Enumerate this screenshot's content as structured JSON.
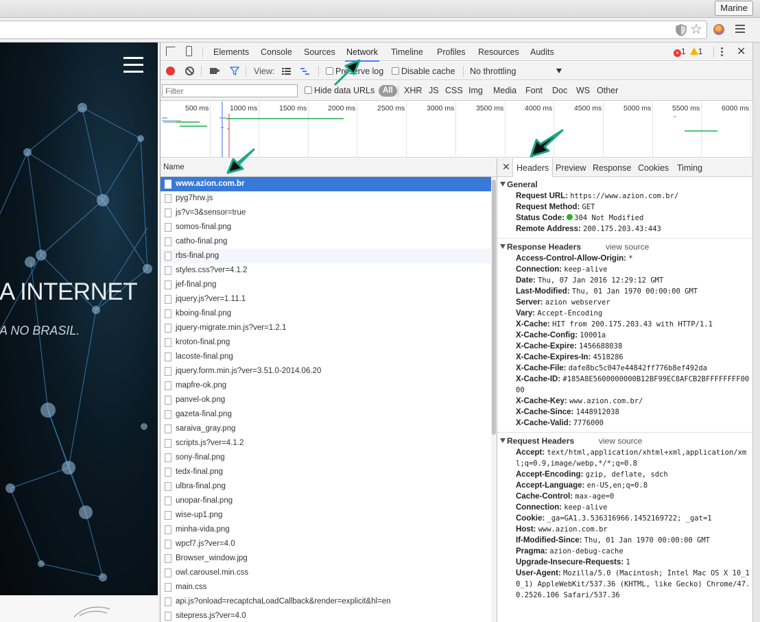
{
  "browser": {
    "profile_name": "Marine",
    "icons": [
      "shield-icon",
      "star-icon",
      "extension-icon",
      "menu-icon"
    ]
  },
  "page": {
    "hero_title": "A INTERNET",
    "hero_subtitle": "A NO BRASIL."
  },
  "devtools": {
    "tabs": [
      "Elements",
      "Console",
      "Sources",
      "Network",
      "Timeline",
      "Profiles",
      "Resources",
      "Audits"
    ],
    "active_tab": "Network",
    "error_count": "1",
    "warning_count": "1",
    "toolbar": {
      "view_label": "View:",
      "preserve_log": "Preserve log",
      "disable_cache": "Disable cache",
      "throttling": "No throttling"
    },
    "filter": {
      "placeholder": "Filter",
      "hide_data_urls": "Hide data URLs",
      "types": [
        "All",
        "XHR",
        "JS",
        "CSS",
        "Img",
        "Media",
        "Font",
        "Doc",
        "WS",
        "Other"
      ]
    },
    "overview_ticks": [
      "500 ms",
      "1000 ms",
      "1500 ms",
      "2000 ms",
      "2500 ms",
      "3000 ms",
      "3500 ms",
      "4000 ms",
      "4500 ms",
      "5000 ms",
      "5500 ms",
      "6000 ms"
    ],
    "name_column": "Name",
    "requests": [
      "www.azion.com.br",
      "pyg7hrw.js",
      "js?v=3&sensor=true",
      "somos-final.png",
      "catho-final.png",
      "rbs-final.png",
      "styles.css?ver=4.1.2",
      "jef-final.png",
      "jquery.js?ver=1.11.1",
      "kboing-final.png",
      "jquery-migrate.min.js?ver=1.2.1",
      "kroton-final.png",
      "lacoste-final.png",
      "jquery.form.min.js?ver=3.51.0-2014.06.20",
      "mapfre-ok.png",
      "panvel-ok.png",
      "gazeta-final.png",
      "saraiva_gray.png",
      "scripts.js?ver=4.1.2",
      "sony-final.png",
      "tedx-final.png",
      "ulbra-final.png",
      "unopar-final.png",
      "wise-up1.png",
      "minha-vida.png",
      "wpcf7.js?ver=4.0",
      "Browser_window.jpg",
      "owl.carousel.min.css",
      "main.css",
      "api.js?onload=recaptchaLoadCallback&render=explicit&hl=en",
      "sitepress.js?ver=4.0"
    ],
    "detail_tabs": [
      "Headers",
      "Preview",
      "Response",
      "Cookies",
      "Timing"
    ],
    "active_detail_tab": "Headers",
    "general": {
      "title": "General",
      "rows": [
        {
          "k": "Request URL:",
          "v": "https://www.azion.com.br/"
        },
        {
          "k": "Request Method:",
          "v": "GET"
        },
        {
          "k": "Status Code:",
          "v": "304 Not Modified"
        },
        {
          "k": "Remote Address:",
          "v": "200.175.203.43:443"
        }
      ]
    },
    "response_headers": {
      "title": "Response Headers",
      "view_source": "view source",
      "rows": [
        {
          "k": "Access-Control-Allow-Origin:",
          "v": "*"
        },
        {
          "k": "Connection:",
          "v": "keep-alive"
        },
        {
          "k": "Date:",
          "v": "Thu, 07 Jan 2016 12:29:12 GMT"
        },
        {
          "k": "Last-Modified:",
          "v": "Thu, 01 Jan 1970 00:00:00 GMT"
        },
        {
          "k": "Server:",
          "v": "azion webserver"
        },
        {
          "k": "Vary:",
          "v": "Accept-Encoding"
        },
        {
          "k": "X-Cache:",
          "v": "HIT from 200.175.203.43 with HTTP/1.1"
        },
        {
          "k": "X-Cache-Config:",
          "v": "10001a"
        },
        {
          "k": "X-Cache-Expire:",
          "v": "1456688038"
        },
        {
          "k": "X-Cache-Expires-In:",
          "v": "4518286"
        },
        {
          "k": "X-Cache-File:",
          "v": "dafe8bc5c047e44842ff776b8ef492da"
        },
        {
          "k": "X-Cache-ID:",
          "v": "#185A8E5600000000B12BF99EC8AFCB2BFFFFFFFF0000"
        },
        {
          "k": "X-Cache-Key:",
          "v": "www.azion.com.br/"
        },
        {
          "k": "X-Cache-Since:",
          "v": "1448912038"
        },
        {
          "k": "X-Cache-Valid:",
          "v": "7776000"
        }
      ]
    },
    "request_headers": {
      "title": "Request Headers",
      "view_source": "view source",
      "rows": [
        {
          "k": "Accept:",
          "v": "text/html,application/xhtml+xml,application/xml;q=0.9,image/webp,*/*;q=0.8"
        },
        {
          "k": "Accept-Encoding:",
          "v": "gzip, deflate, sdch"
        },
        {
          "k": "Accept-Language:",
          "v": "en-US,en;q=0.8"
        },
        {
          "k": "Cache-Control:",
          "v": "max-age=0"
        },
        {
          "k": "Connection:",
          "v": "keep-alive"
        },
        {
          "k": "Cookie:",
          "v": "_ga=GA1.3.536316966.1452169722; _gat=1"
        },
        {
          "k": "Host:",
          "v": "www.azion.com.br"
        },
        {
          "k": "If-Modified-Since:",
          "v": "Thu, 01 Jan 1970 00:00:00 GMT"
        },
        {
          "k": "Pragma:",
          "v": "azion-debug-cache"
        },
        {
          "k": "Upgrade-Insecure-Requests:",
          "v": "1"
        },
        {
          "k": "User-Agent:",
          "v": "Mozilla/5.0 (Macintosh; Intel Mac OS X 10_10_1) AppleWebKit/537.36 (KHTML, like Gecko) Chrome/47.0.2526.106 Safari/537.36"
        }
      ]
    }
  },
  "colors": {
    "accent": "#3e82f7",
    "selected_row": "#3879d9",
    "record": "#e53935",
    "status_ok": "#2fb12f",
    "annotation_arrow": "#1aa687"
  }
}
